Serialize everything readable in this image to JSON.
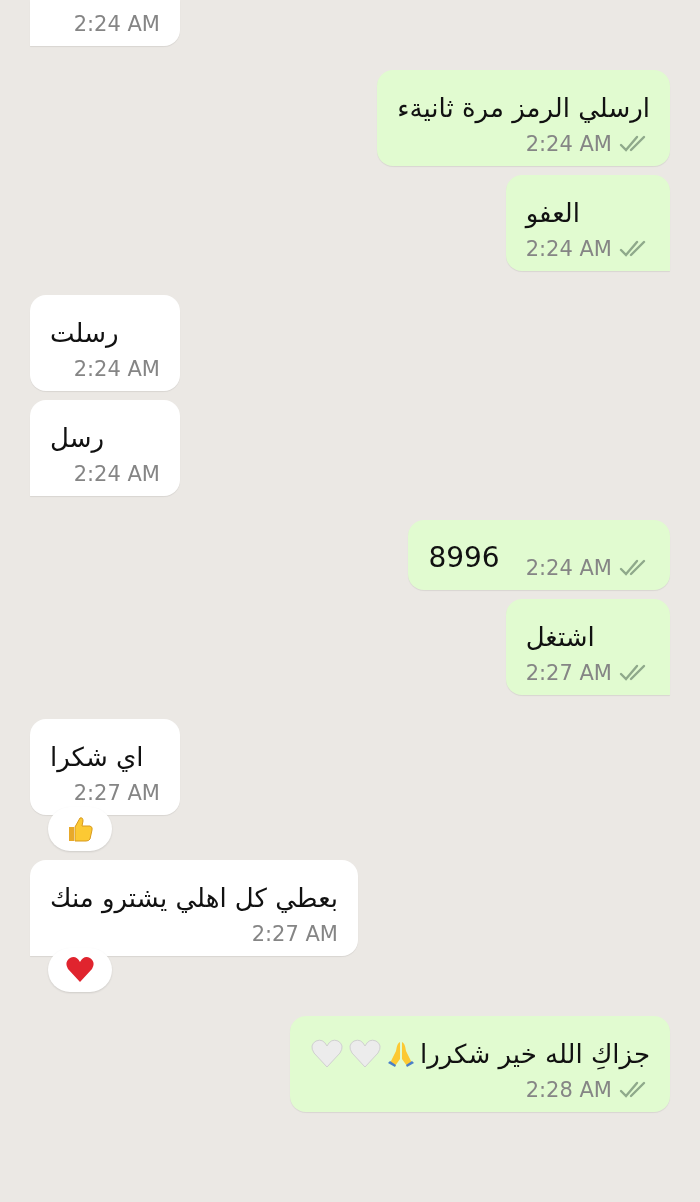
{
  "messages": [
    {
      "kind": "incoming",
      "time": "2:24 AM",
      "inline": false,
      "cut_top": true,
      "tail": true
    },
    {
      "kind": "outgoing",
      "text": "ارسلي الرمز مرة ثانيةء",
      "time": "2:24 AM",
      "inline": false,
      "cut_top": false,
      "tail": false
    },
    {
      "kind": "outgoing",
      "text": "العفو",
      "time": "2:24 AM",
      "inline": false,
      "cut_top": false,
      "tail": true
    },
    {
      "kind": "incoming",
      "text": "رسلت",
      "time": "2:24 AM",
      "inline": false,
      "cut_top": false,
      "tail": false
    },
    {
      "kind": "incoming",
      "text": "رسل",
      "time": "2:24 AM",
      "inline": false,
      "cut_top": false,
      "tail": true
    },
    {
      "kind": "outgoing",
      "text": "8996",
      "time": "2:24 AM",
      "inline": true,
      "cut_top": false,
      "tail": false
    },
    {
      "kind": "outgoing",
      "text": "اشتغل",
      "time": "2:27 AM",
      "inline": false,
      "cut_top": false,
      "tail": true
    },
    {
      "kind": "incoming",
      "text": "اي شكرا",
      "time": "2:27 AM",
      "inline": false,
      "cut_top": false,
      "tail": false,
      "reaction": {
        "kind": "thumbs"
      }
    },
    {
      "kind": "incoming",
      "text": "بعطي كل اهلي يشترو منك",
      "time": "2:27 AM",
      "inline": false,
      "cut_top": false,
      "tail": true,
      "reaction": {
        "kind": "heart"
      }
    },
    {
      "kind": "outgoing",
      "text": "جزاكِ الله خير شكررا",
      "emojis": [
        {
          "kind": "pray"
        },
        {
          "kind": "whiteheart"
        },
        {
          "kind": "whiteheart"
        }
      ],
      "time": "2:28 AM",
      "inline": false,
      "cut_top": false,
      "tail": false
    }
  ]
}
